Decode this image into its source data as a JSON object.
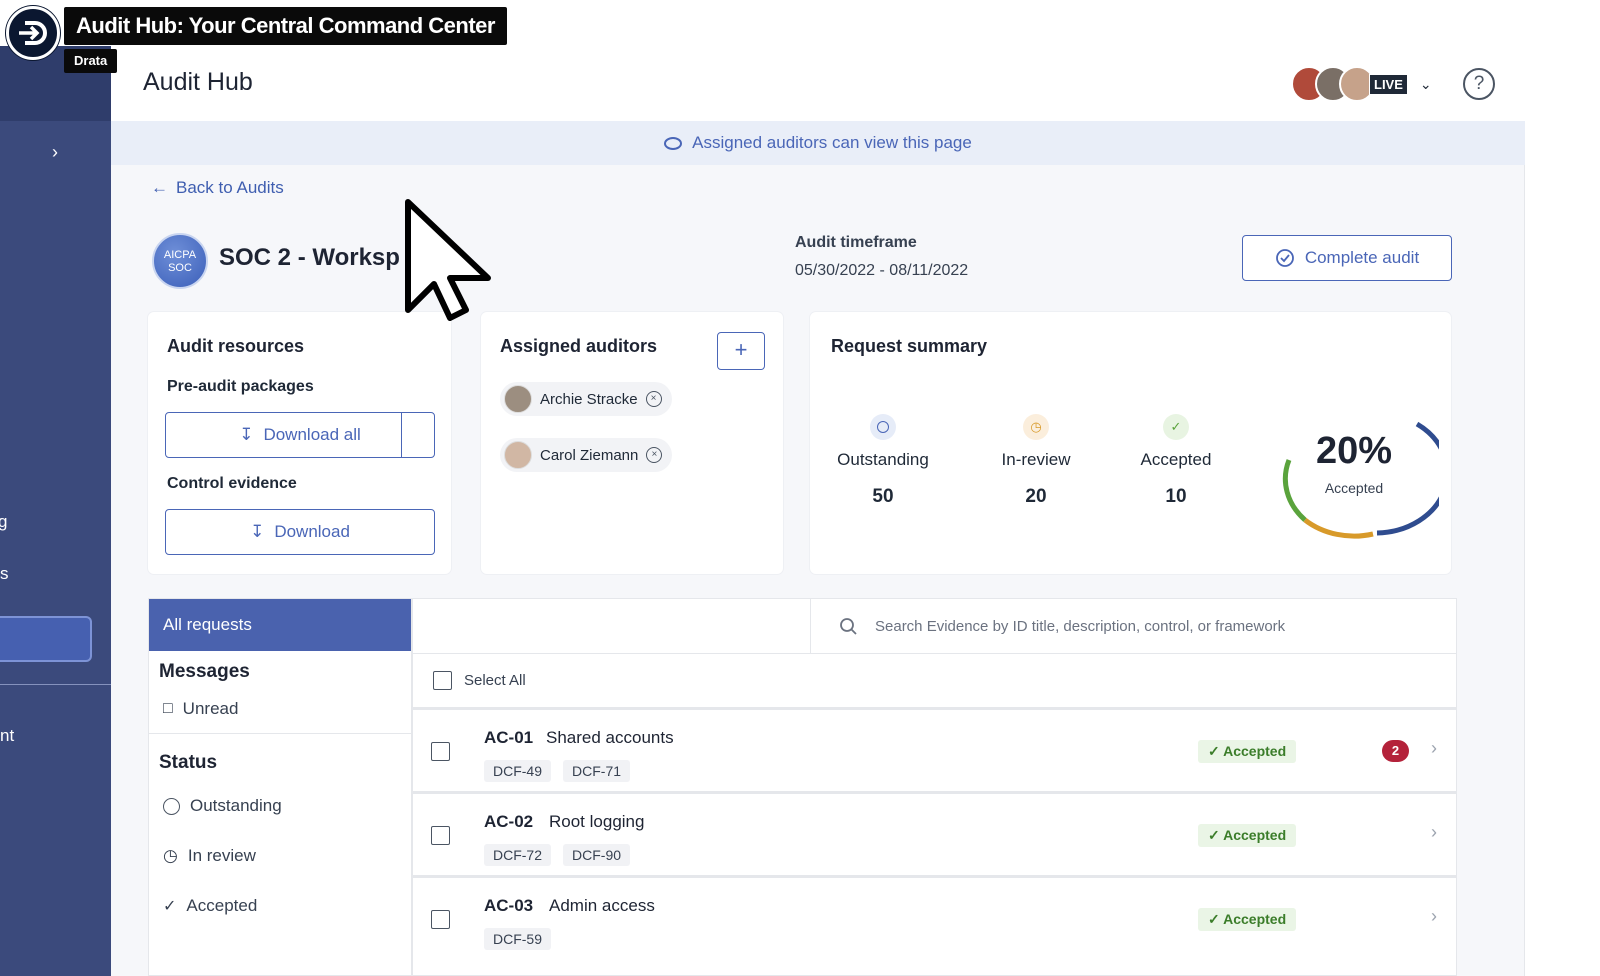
{
  "video": {
    "title": "Audit Hub: Your Central Command Center",
    "subtitle": "Drata"
  },
  "nav": {
    "expand_icon": "chevron-right-icon",
    "fragments": [
      "g",
      "s",
      "nt"
    ]
  },
  "header": {
    "title": "Audit Hub",
    "live_label": "LIVE",
    "help_icon": "help-circle-icon"
  },
  "banner": {
    "text": "Assigned auditors can view this page",
    "icon": "eye-icon"
  },
  "back_link": "Back to Audits",
  "audit": {
    "logo_text": "AICPA SOC",
    "title": "SOC 2 - Worksp",
    "timeframe_label": "Audit timeframe",
    "timeframe_value": "05/30/2022 - 08/11/2022",
    "complete_label": "Complete audit"
  },
  "resources": {
    "title": "Audit resources",
    "pre_audit_label": "Pre-audit packages",
    "download_all_label": "Download all",
    "control_evidence_label": "Control evidence",
    "download_label": "Download"
  },
  "auditors": {
    "title": "Assigned auditors",
    "add_label": "+",
    "people": [
      {
        "name": "Archie Stracke"
      },
      {
        "name": "Carol Ziemann"
      }
    ]
  },
  "summary": {
    "title": "Request summary",
    "stats": [
      {
        "label": "Outstanding",
        "value": "50",
        "color": "#4a66b7"
      },
      {
        "label": "In-review",
        "value": "20",
        "color": "#d89a2a"
      },
      {
        "label": "Accepted",
        "value": "10",
        "color": "#5aa33c"
      }
    ],
    "accepted_percent": "20%",
    "accepted_label": "Accepted",
    "accepted_fraction": 0.2
  },
  "filters": {
    "active": "All requests",
    "messages_heading": "Messages",
    "unread_label": "Unread",
    "status_heading": "Status",
    "status_items": [
      "Outstanding",
      "In review",
      "Accepted"
    ]
  },
  "search": {
    "placeholder": "Search Evidence by ID title, description, control, or framework"
  },
  "select_all_label": "Select All",
  "requests": [
    {
      "id": "AC-01",
      "name": "Shared accounts",
      "tags": [
        "DCF-49",
        "DCF-71"
      ],
      "status": "Accepted",
      "messages": "2"
    },
    {
      "id": "AC-02",
      "name": "Root logging",
      "tags": [
        "DCF-72",
        "DCF-90"
      ],
      "status": "Accepted",
      "messages": ""
    },
    {
      "id": "AC-03",
      "name": "Admin access",
      "tags": [
        "DCF-59"
      ],
      "status": "Accepted",
      "messages": ""
    }
  ]
}
